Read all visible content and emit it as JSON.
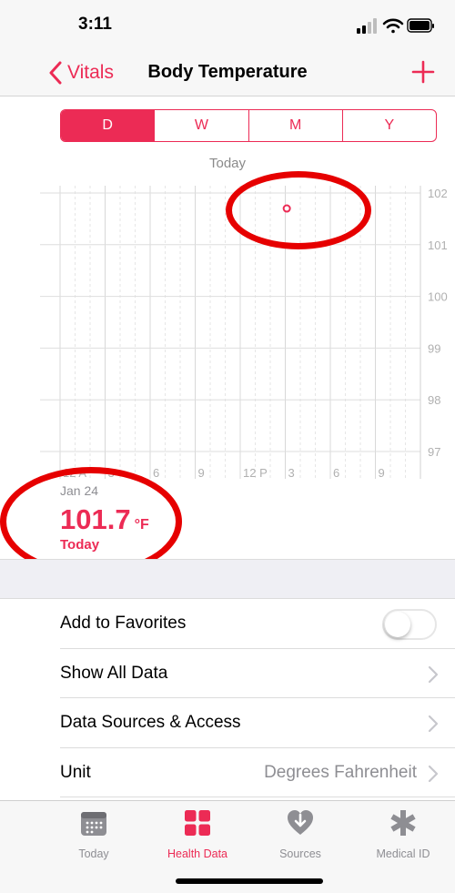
{
  "status": {
    "time": "3:11"
  },
  "nav": {
    "back_label": "Vitals",
    "title": "Body Temperature"
  },
  "segments": [
    {
      "label": "D",
      "active": true
    },
    {
      "label": "W",
      "active": false
    },
    {
      "label": "M",
      "active": false
    },
    {
      "label": "Y",
      "active": false
    }
  ],
  "chart_data": {
    "type": "scatter",
    "title": "Today",
    "x_unit": "hour",
    "xlim": [
      0,
      24
    ],
    "ylim": [
      97,
      102.2
    ],
    "y_ticks": [
      102,
      101,
      100,
      99,
      98,
      97
    ],
    "x_ticks": [
      {
        "hour": 0,
        "label": "12 A"
      },
      {
        "hour": 3,
        "label": "3"
      },
      {
        "hour": 6,
        "label": "6"
      },
      {
        "hour": 9,
        "label": "9"
      },
      {
        "hour": 12,
        "label": "12 P"
      },
      {
        "hour": 15,
        "label": "3"
      },
      {
        "hour": 18,
        "label": "6"
      },
      {
        "hour": 21,
        "label": "9"
      }
    ],
    "points": [
      {
        "x": 15.1,
        "y": 101.7
      }
    ],
    "accent": "#ec2b55"
  },
  "readout": {
    "date": "Jan 24",
    "value": "101.7",
    "unit": "°F",
    "period": "Today"
  },
  "list": {
    "favorites_label": "Add to Favorites",
    "show_all_label": "Show All Data",
    "sources_label": "Data Sources & Access",
    "unit_label": "Unit",
    "unit_value": "Degrees Fahrenheit"
  },
  "tabs": [
    {
      "label": "Today"
    },
    {
      "label": "Health Data"
    },
    {
      "label": "Sources"
    },
    {
      "label": "Medical ID"
    }
  ],
  "colors": {
    "accent": "#ec2b55",
    "annotation": "#e60000"
  }
}
